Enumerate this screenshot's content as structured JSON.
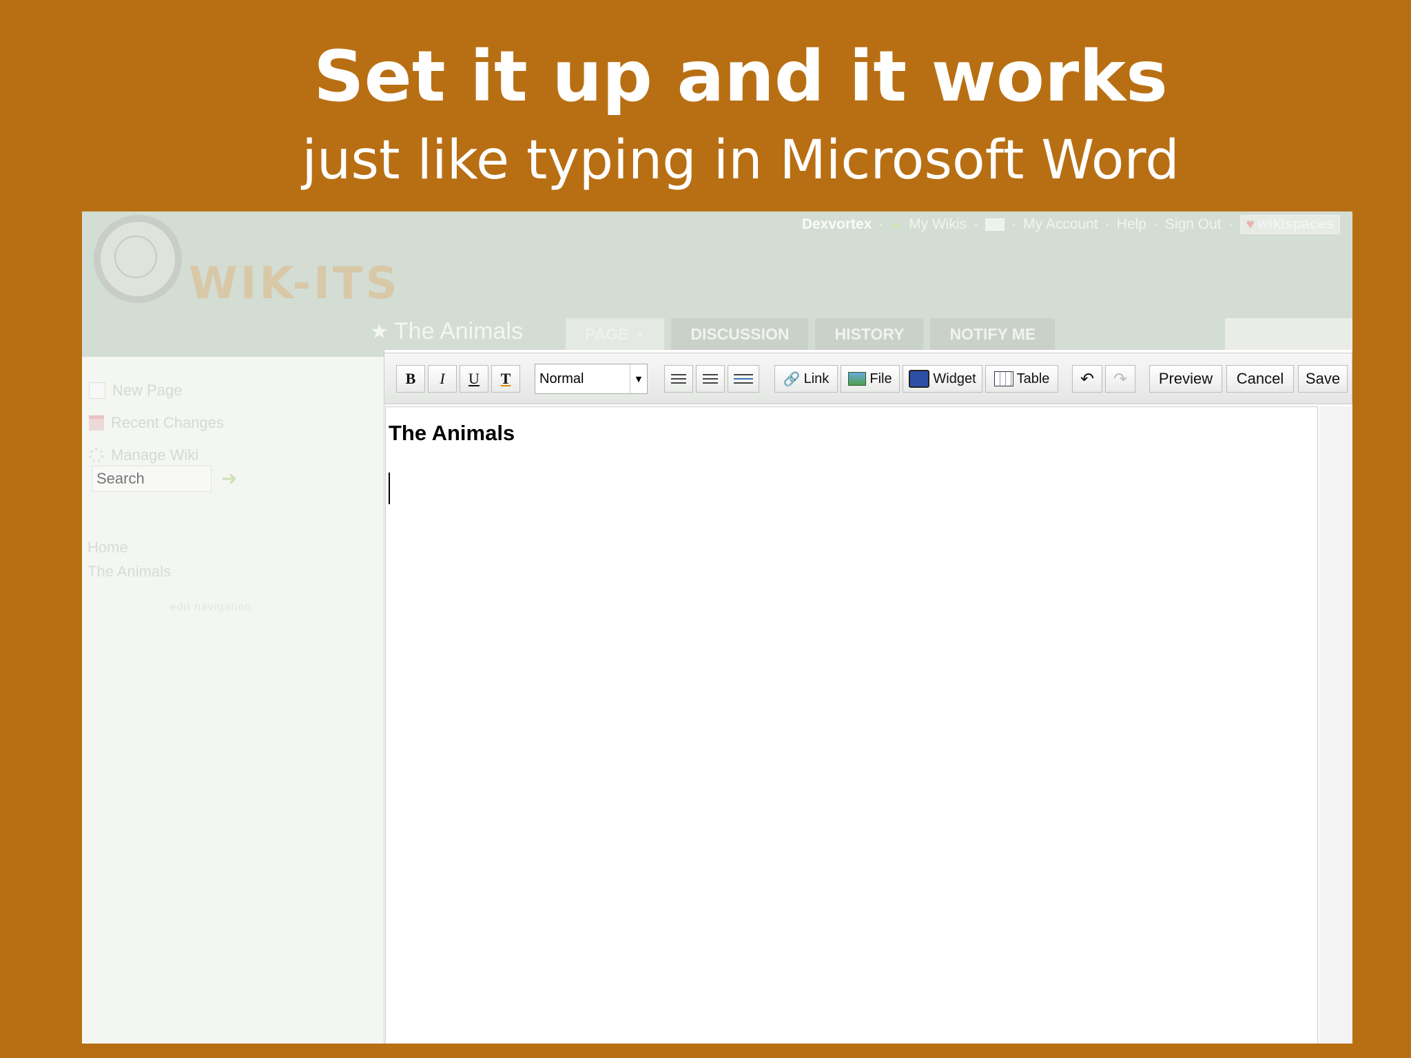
{
  "slide": {
    "title": "Set it up and it works",
    "subtitle": "just like typing in Microsoft Word"
  },
  "wiki": {
    "logo_text": "WIK-ITS",
    "top_links": {
      "user": "Dexvortex",
      "my_wikis": "My Wikis",
      "my_account": "My Account",
      "help": "Help",
      "sign_out": "Sign Out",
      "brand": "wikispaces",
      "separator": "·"
    },
    "page_title": "The Animals",
    "tabs": [
      {
        "label": "PAGE",
        "active": true
      },
      {
        "label": "DISCUSSION",
        "active": false
      },
      {
        "label": "HISTORY",
        "active": false
      },
      {
        "label": "NOTIFY ME",
        "active": false
      }
    ],
    "sidebar": {
      "items": [
        {
          "label": "New Page",
          "icon": "page-icon"
        },
        {
          "label": "Recent Changes",
          "icon": "calendar-icon"
        },
        {
          "label": "Manage Wiki",
          "icon": "gear-icon"
        }
      ],
      "search_placeholder": "Search",
      "nav_links": [
        "Home",
        "The Animals"
      ],
      "edit_navigation": "edit navigation"
    },
    "toolbar": {
      "bold": "B",
      "italic": "I",
      "underline": "U",
      "format_value": "Normal",
      "link": "Link",
      "file": "File",
      "widget": "Widget",
      "table": "Table",
      "preview": "Preview",
      "cancel": "Cancel",
      "save": "Save"
    },
    "document": {
      "heading": "The Animals"
    }
  }
}
